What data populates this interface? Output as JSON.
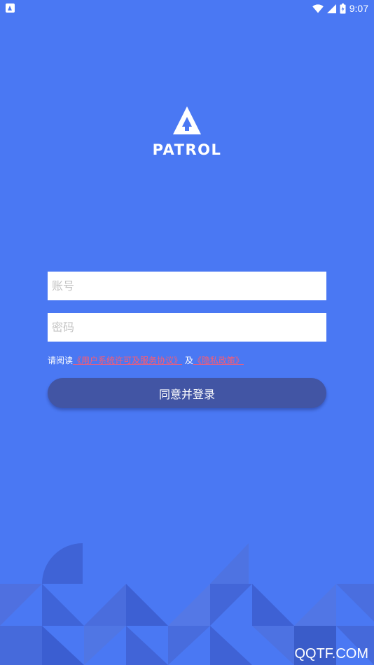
{
  "status_bar": {
    "time": "9:07",
    "icons": [
      "app-notification-icon",
      "wifi-icon",
      "signal-icon",
      "battery-icon"
    ]
  },
  "logo": {
    "text": "PATROL",
    "icon": "tree-triangle-logo"
  },
  "login_form": {
    "account_placeholder": "账号",
    "account_value": "",
    "password_placeholder": "密码",
    "password_value": ""
  },
  "agreement": {
    "prefix": "请阅读",
    "link1": "《用户系统许可及服务协议》",
    "conjunction": "及",
    "link2": "《隐私政策》"
  },
  "submit_button": {
    "label": "同意并登录"
  },
  "watermark": "QQTF.COM",
  "colors": {
    "background": "#4a78f3",
    "button": "#4255a4",
    "link": "#ff5a6e"
  }
}
